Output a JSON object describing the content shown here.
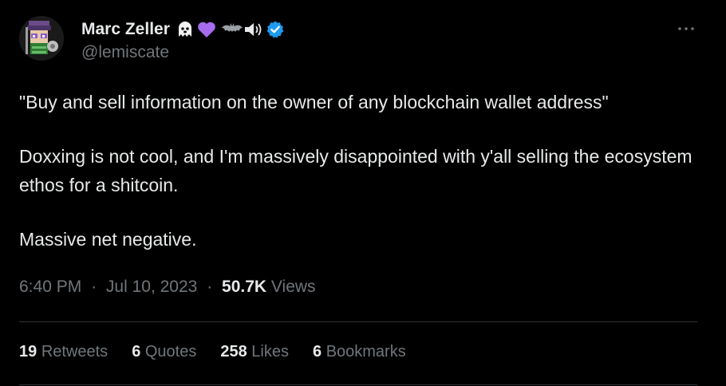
{
  "author": {
    "display_name": "Marc Zeller",
    "handle": "@lemiscate",
    "avatar_icon": "pixel-art-character-avatar",
    "name_emojis": [
      "ghost-icon",
      "purple-heart-icon",
      "bat-icon",
      "speaker-icon"
    ],
    "verified_icon": "verified-badge-icon",
    "verified_color": "#1d9bf0"
  },
  "more_icon": "ellipsis-icon",
  "tweet": {
    "paragraphs": [
      "\"Buy and sell information on the owner of any blockchain wallet address\"",
      "Doxxing is not cool, and I'm massively disappointed with y'all selling the ecosystem ethos for a shitcoin.",
      "Massive net negative."
    ]
  },
  "meta": {
    "time": "6:40 PM",
    "separator": "·",
    "date": "Jul 10, 2023",
    "views_count": "50.7K",
    "views_label": "Views"
  },
  "stats": [
    {
      "count": "19",
      "label": "Retweets"
    },
    {
      "count": "6",
      "label": "Quotes"
    },
    {
      "count": "258",
      "label": "Likes"
    },
    {
      "count": "6",
      "label": "Bookmarks"
    }
  ],
  "colors": {
    "background": "#000000",
    "text_primary": "#e7e9ea",
    "text_secondary": "#71767b",
    "divider": "#2f3336"
  }
}
